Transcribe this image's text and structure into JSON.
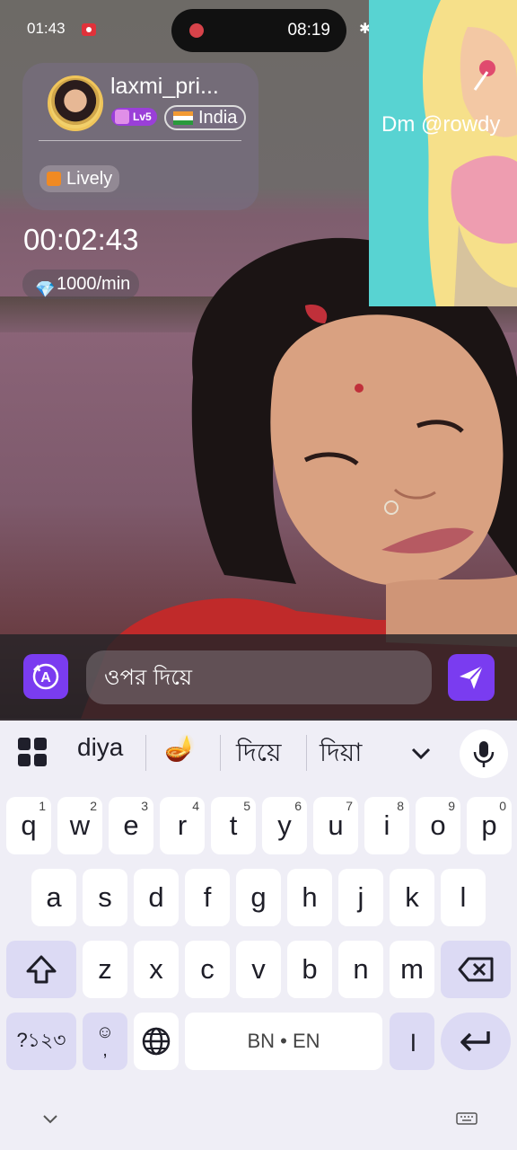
{
  "status_bar": {
    "time": "01:43",
    "call_timer": "08:19"
  },
  "profile": {
    "username": "laxmi_pri...",
    "level": "Lv5",
    "country": "India",
    "tag": "Lively"
  },
  "call": {
    "timer": "00:02:43",
    "rate": "1000/min"
  },
  "pip": {
    "overlay_text": "Dm    @rowdy"
  },
  "message": {
    "input_value": "ওপর দিয়ে",
    "translate_icon": "translate-icon",
    "send_icon": "send-icon"
  },
  "keyboard": {
    "suggestions": [
      "diya",
      "🪔",
      "দিয়ে",
      "দিয়া"
    ],
    "row1": [
      {
        "k": "q",
        "n": "1"
      },
      {
        "k": "w",
        "n": "2"
      },
      {
        "k": "e",
        "n": "3"
      },
      {
        "k": "r",
        "n": "4"
      },
      {
        "k": "t",
        "n": "5"
      },
      {
        "k": "y",
        "n": "6"
      },
      {
        "k": "u",
        "n": "7"
      },
      {
        "k": "i",
        "n": "8"
      },
      {
        "k": "o",
        "n": "9"
      },
      {
        "k": "p",
        "n": "0"
      }
    ],
    "row2": [
      "a",
      "s",
      "d",
      "f",
      "g",
      "h",
      "j",
      "k",
      "l"
    ],
    "row3": [
      "z",
      "x",
      "c",
      "v",
      "b",
      "n",
      "m"
    ],
    "symbols_key": "?১২৩",
    "emoji_key_glyph": "☺",
    "emoji_key_sub": ",",
    "space_label": "BN • EN",
    "period_key": "।"
  }
}
